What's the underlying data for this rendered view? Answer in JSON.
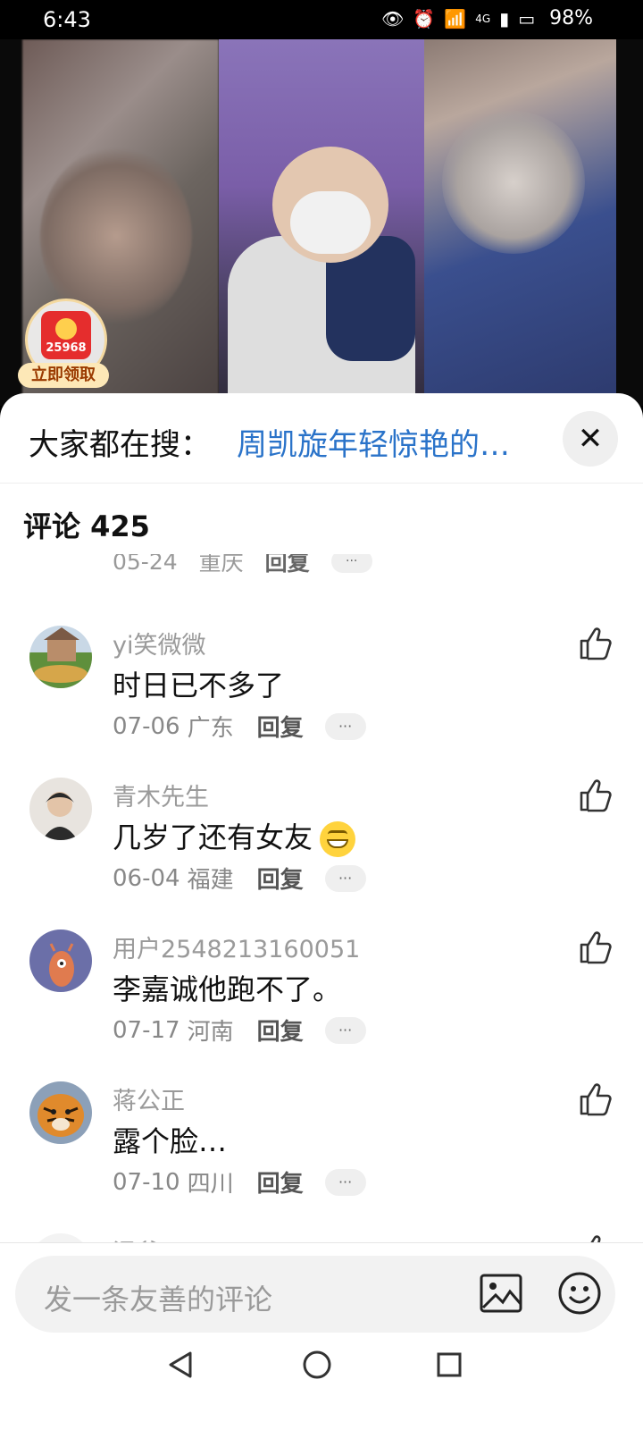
{
  "status_bar": {
    "time": "6:43",
    "signal": "4G",
    "battery": "98%"
  },
  "video": {
    "red_packet_number": "25968",
    "red_packet_label": "立即领取"
  },
  "search": {
    "prefix": "大家都在搜：",
    "term": "周凯旋年轻惊艳的…",
    "close_icon": "close-icon"
  },
  "comments_header": {
    "title": "评论 425"
  },
  "partial_meta": {
    "date": "05-24",
    "location": "重庆",
    "reply": "回复",
    "more": "···"
  },
  "comments": [
    {
      "user": "yi笑微微",
      "text": "时日已不多了",
      "date": "07-06",
      "location": "广东",
      "reply": "回复",
      "more": "···"
    },
    {
      "user": "青木先生",
      "text": "几岁了还有女友",
      "date": "06-04",
      "location": "福建",
      "reply": "回复",
      "more": "···"
    },
    {
      "user": "用户2548213160051",
      "text": "李嘉诚他跑不了。",
      "date": "07-17",
      "location": "河南",
      "reply": "回复",
      "more": "···"
    },
    {
      "user": "蒋公正",
      "text": "露个脸…",
      "date": "07-10",
      "location": "四川",
      "reply": "回复",
      "more": "···"
    },
    {
      "user": "涵爷",
      "text": "",
      "date": "",
      "location": "",
      "reply": "",
      "more": ""
    }
  ],
  "input": {
    "placeholder": "发一条友善的评论"
  }
}
